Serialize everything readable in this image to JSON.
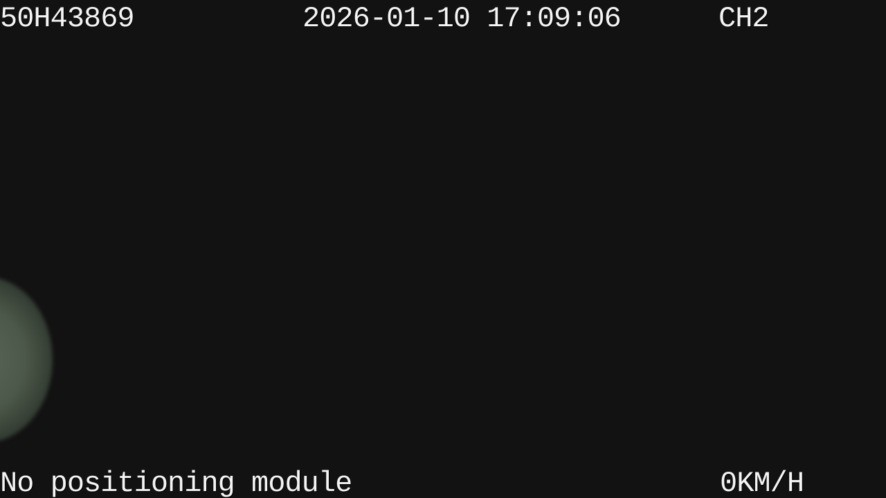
{
  "overlay": {
    "plate": "50H43869",
    "datetime": "2026-01-10 17:09:06",
    "channel": "CH2",
    "gps_status": "No positioning module",
    "speed": "0KM/H"
  }
}
